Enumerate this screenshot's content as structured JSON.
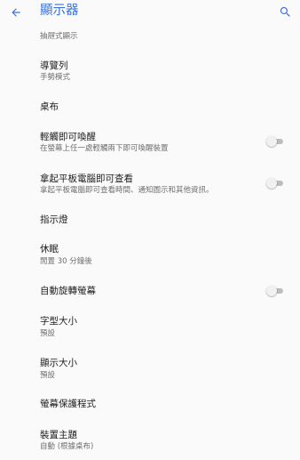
{
  "header": {
    "title": "顯示器"
  },
  "colors": {
    "accent": "#3b73d9",
    "primary_text": "#212121",
    "secondary_text": "#6f6f6f",
    "background": "#fafafa",
    "toggle_track": "#bdbdbd"
  },
  "settings": {
    "cropped_item_subtitle": "抽屜式顯示",
    "items": [
      {
        "title": "導覽列",
        "subtitle": "手勢模式"
      },
      {
        "title": "桌布"
      },
      {
        "title": "輕觸即可喚醒",
        "subtitle": "在螢幕上任一處輕觸兩下即可喚醒裝置",
        "toggle": false
      },
      {
        "title": "拿起平板電腦即可查看",
        "subtitle": "拿起平板電腦即可查看時間、通知圖示和其他資訊。",
        "toggle": false
      },
      {
        "title": "指示燈"
      },
      {
        "title": "休眠",
        "subtitle": "閒置 30 分鐘後"
      },
      {
        "title": "自動旋轉螢幕",
        "toggle": false
      },
      {
        "title": "字型大小",
        "subtitle": "預設"
      },
      {
        "title": "顯示大小",
        "subtitle": "預設"
      },
      {
        "title": "螢幕保護程式"
      },
      {
        "title": "裝置主題",
        "subtitle": "自動 (根據桌布)"
      }
    ]
  }
}
